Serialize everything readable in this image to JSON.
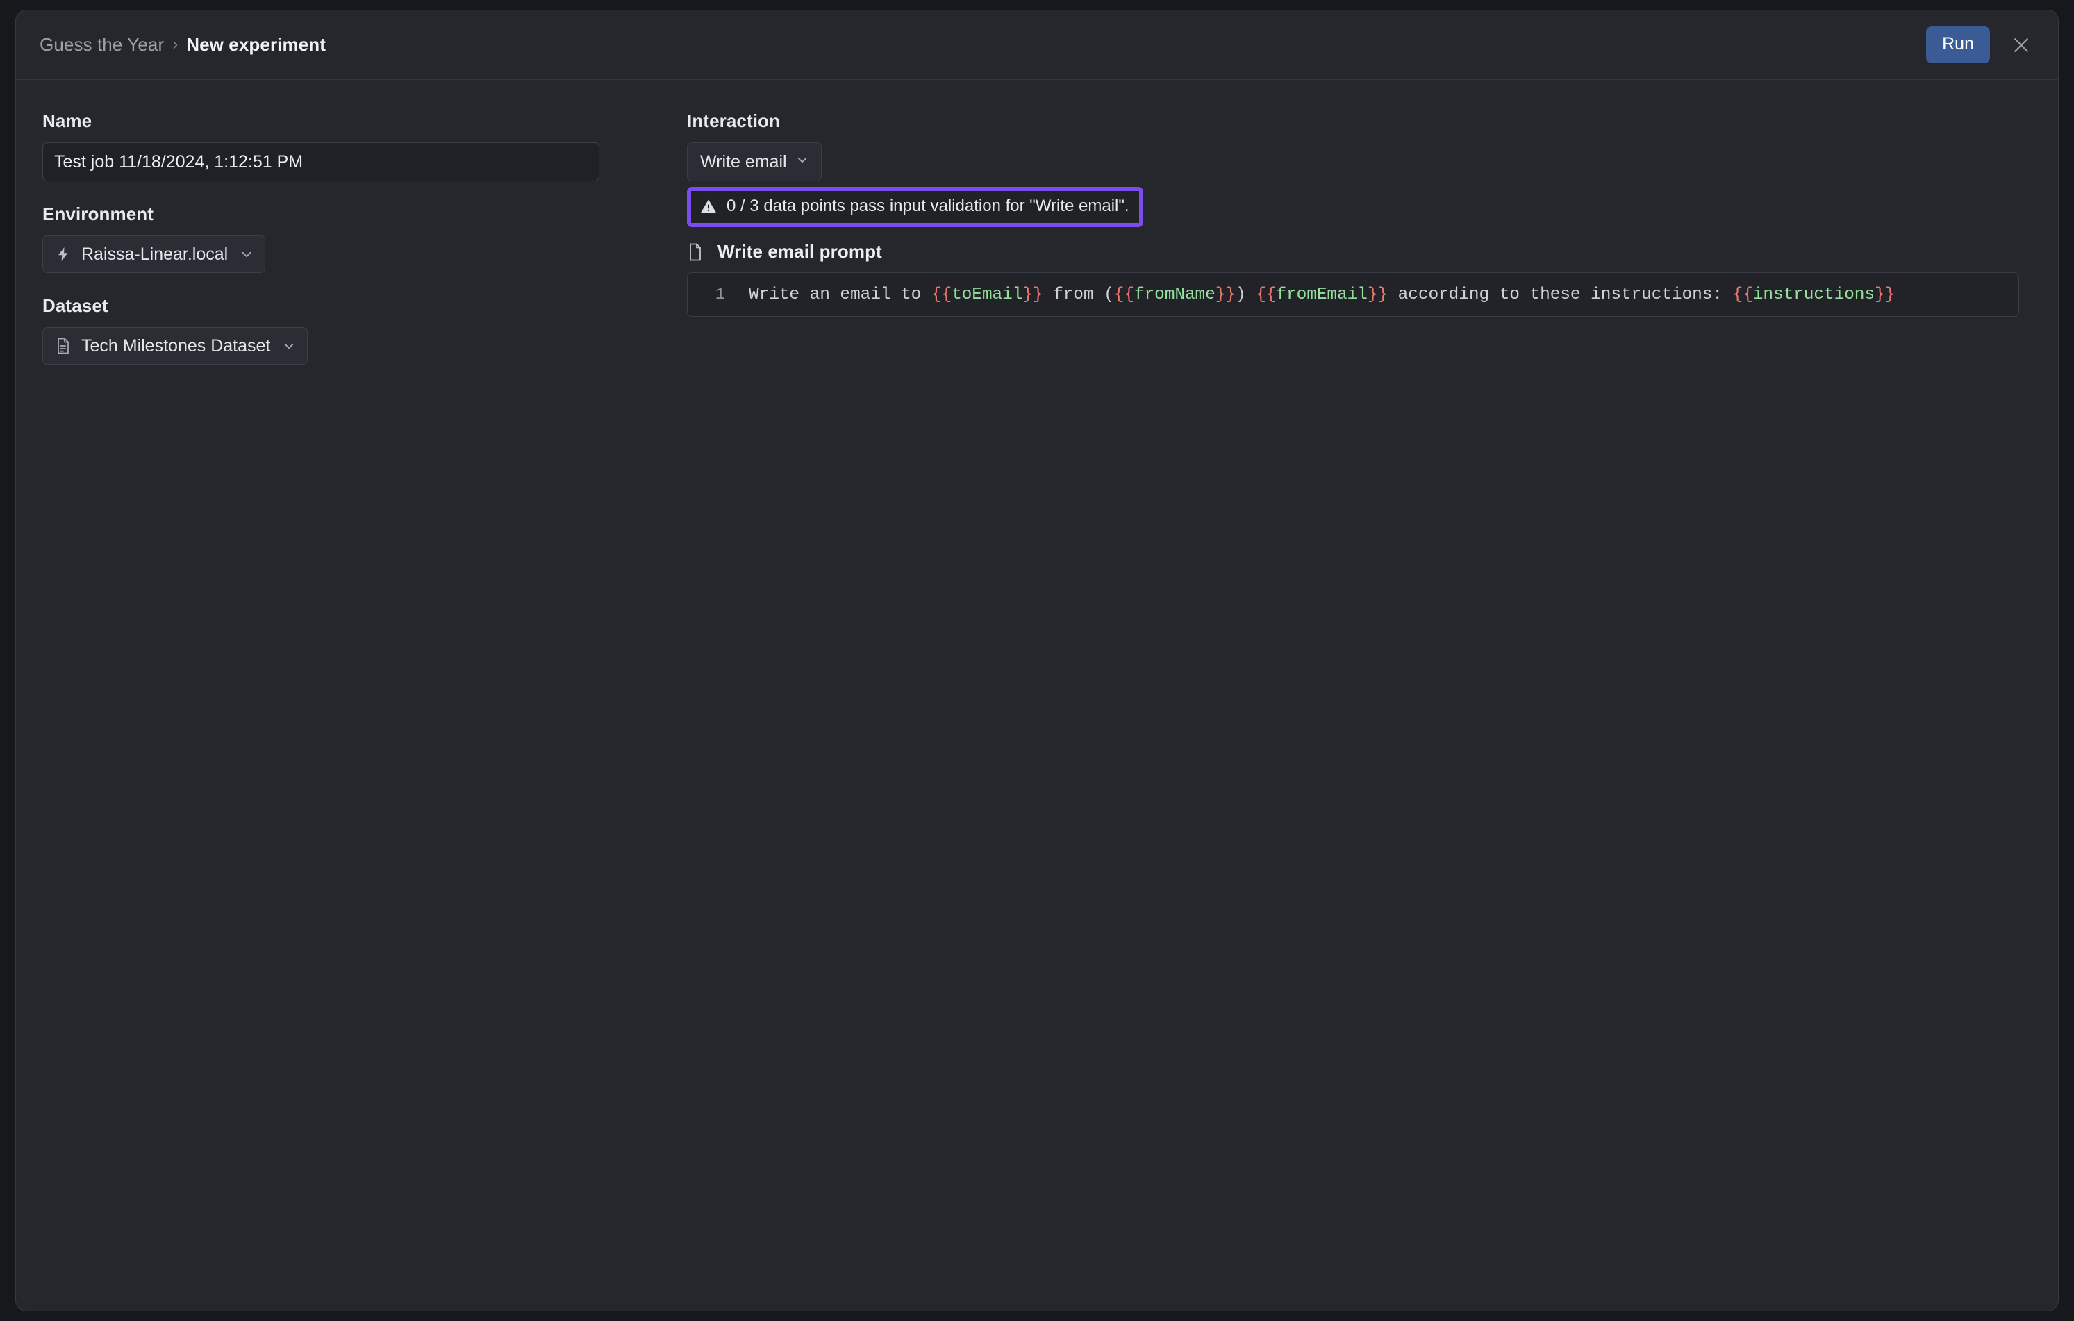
{
  "titlebar": {
    "breadcrumb": {
      "parent": "Guess the Year",
      "separator": "›",
      "current": "New experiment"
    },
    "run_label": "Run",
    "close_icon": "close-icon"
  },
  "left": {
    "name": {
      "label": "Name",
      "value": "Test job 11/18/2024, 1:12:51 PM",
      "placeholder": "Name"
    },
    "environment": {
      "label": "Environment",
      "value": "Raissa-Linear.local",
      "icon": "lightning-bolt-icon",
      "chevron": "chevron-down-icon"
    },
    "dataset": {
      "label": "Dataset",
      "value": "Tech Milestones Dataset",
      "icon": "document-lines-icon",
      "chevron": "chevron-down-icon"
    }
  },
  "right": {
    "section_label": "Interaction",
    "interaction": {
      "value": "Write email",
      "chevron": "chevron-down-icon"
    },
    "warning": {
      "icon": "warning-triangle-icon",
      "text": "0 / 3 data points pass input validation for \"Write email\".",
      "highlight_color": "#7c4ded"
    },
    "prompt": {
      "icon": "file-icon",
      "title": "Write email prompt",
      "line_number": "1",
      "text": "Write an email to {{toEmail}} from ({{fromName}}) {{fromEmail}} according to these instructions: {{instructions}}",
      "tokens": [
        {
          "t": "Write an email to ",
          "k": "plain"
        },
        {
          "t": "{{",
          "k": "brace"
        },
        {
          "t": "toEmail",
          "k": "var"
        },
        {
          "t": "}}",
          "k": "brace"
        },
        {
          "t": " from (",
          "k": "plain"
        },
        {
          "t": "{{",
          "k": "brace"
        },
        {
          "t": "fromName",
          "k": "var"
        },
        {
          "t": "}}",
          "k": "brace"
        },
        {
          "t": ") ",
          "k": "plain"
        },
        {
          "t": "{{",
          "k": "brace"
        },
        {
          "t": "fromEmail",
          "k": "var"
        },
        {
          "t": "}}",
          "k": "brace"
        },
        {
          "t": " according to these instructions: ",
          "k": "plain"
        },
        {
          "t": "{{",
          "k": "brace"
        },
        {
          "t": "instructions",
          "k": "var"
        },
        {
          "t": "}}",
          "k": "brace"
        }
      ]
    }
  },
  "colors": {
    "window_bg": "#25272d",
    "page_bg": "#16181c",
    "accent_run": "#3a5b96",
    "highlight_purple": "#7c4ded",
    "code_var_green": "#93e09a",
    "code_brace_red": "#e8786d"
  }
}
